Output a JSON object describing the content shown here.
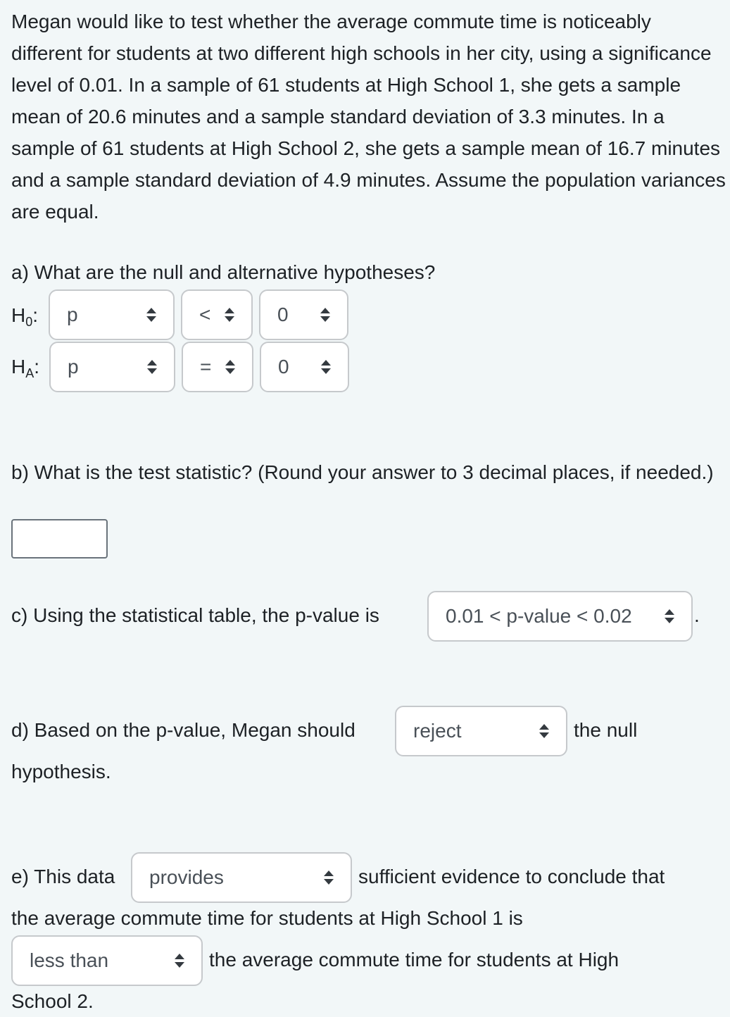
{
  "problem": {
    "text": "Megan would like to test whether the average commute time is noticeably different for students at two different high schools in her city, using a significance level of 0.01. In a sample of 61 students at High School 1, she gets a sample mean of 20.6 minutes and a sample standard deviation of 3.3 minutes. In a sample of 61 students at High School 2, she gets a sample mean of 16.7 minutes and a sample standard deviation of 4.9 minutes. Assume the population variances are equal."
  },
  "part_a": {
    "question": "a) What are the null and alternative hypotheses?",
    "h0": {
      "label_main": "H",
      "label_sub": "0",
      "colon": ":",
      "param": "p",
      "operator": "<",
      "value": "0"
    },
    "ha": {
      "label_main": "H",
      "label_sub": "A",
      "colon": ":",
      "param": "p",
      "operator": "=",
      "value": "0"
    }
  },
  "part_b": {
    "question": "b) What is the test statistic? (Round your answer to 3 decimal places, if needed.)",
    "answer_value": ""
  },
  "part_c": {
    "prefix": "c) Using the statistical table, the p-value is",
    "selected": "0.01 < p-value < 0.02",
    "suffix": "."
  },
  "part_d": {
    "prefix": "d) Based on the p-value, Megan should",
    "selected": "reject",
    "suffix": "the null",
    "line2": "hypothesis."
  },
  "part_e": {
    "prefix": "e) This data",
    "selected1": "provides",
    "mid1": "sufficient evidence to conclude that",
    "line2": "the average commute time for students at High School 1 is",
    "selected2": "less than",
    "mid2": "the average commute time for students at High",
    "line4": "School 2."
  }
}
